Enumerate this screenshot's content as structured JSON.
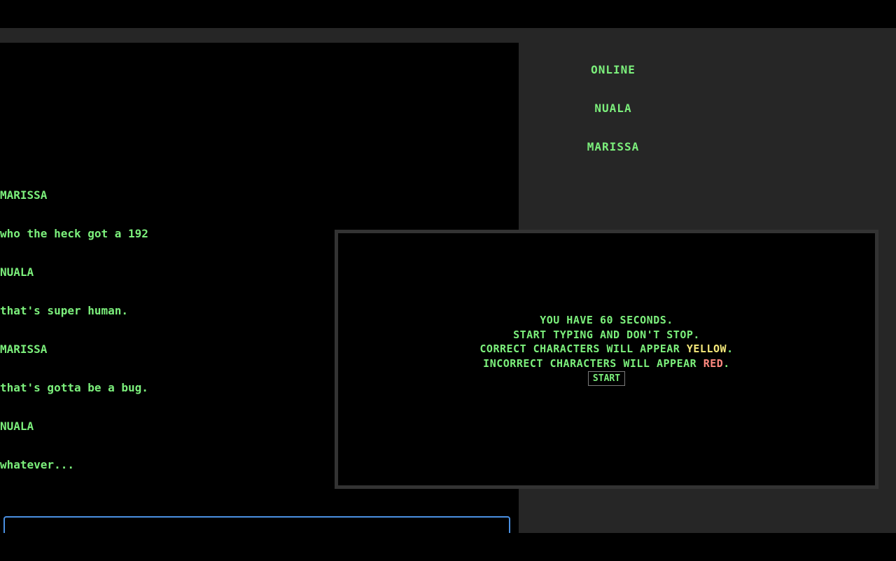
{
  "online": {
    "heading": "ONLINE",
    "users": [
      "NUALA",
      "MARISSA"
    ]
  },
  "chat": {
    "messages": [
      {
        "author": "MARISSA",
        "text": "who the heck got a 192"
      },
      {
        "author": "NUALA",
        "text": "that's super human."
      },
      {
        "author": "MARISSA",
        "text": "that's gotta be a bug."
      },
      {
        "author": "NUALA",
        "text": "whatever..."
      }
    ],
    "input_value": ""
  },
  "modal": {
    "line1": "YOU HAVE 60 SECONDS.",
    "line2": "START TYPING AND DON'T STOP.",
    "line3_prefix": "CORRECT CHARACTERS WILL APPEAR ",
    "line3_color_word": "YELLOW",
    "line3_suffix": ".",
    "line4_prefix": "INCORRECT CHARACTERS WILL APPEAR ",
    "line4_color_word": "RED",
    "line4_suffix": ".",
    "start_label": "START"
  },
  "colors": {
    "text_green": "#7cf07c",
    "highlight_yellow": "#f5e87a",
    "highlight_red": "#ff8a80",
    "panel_gray": "#262626",
    "input_border_blue": "#4a90e2"
  }
}
